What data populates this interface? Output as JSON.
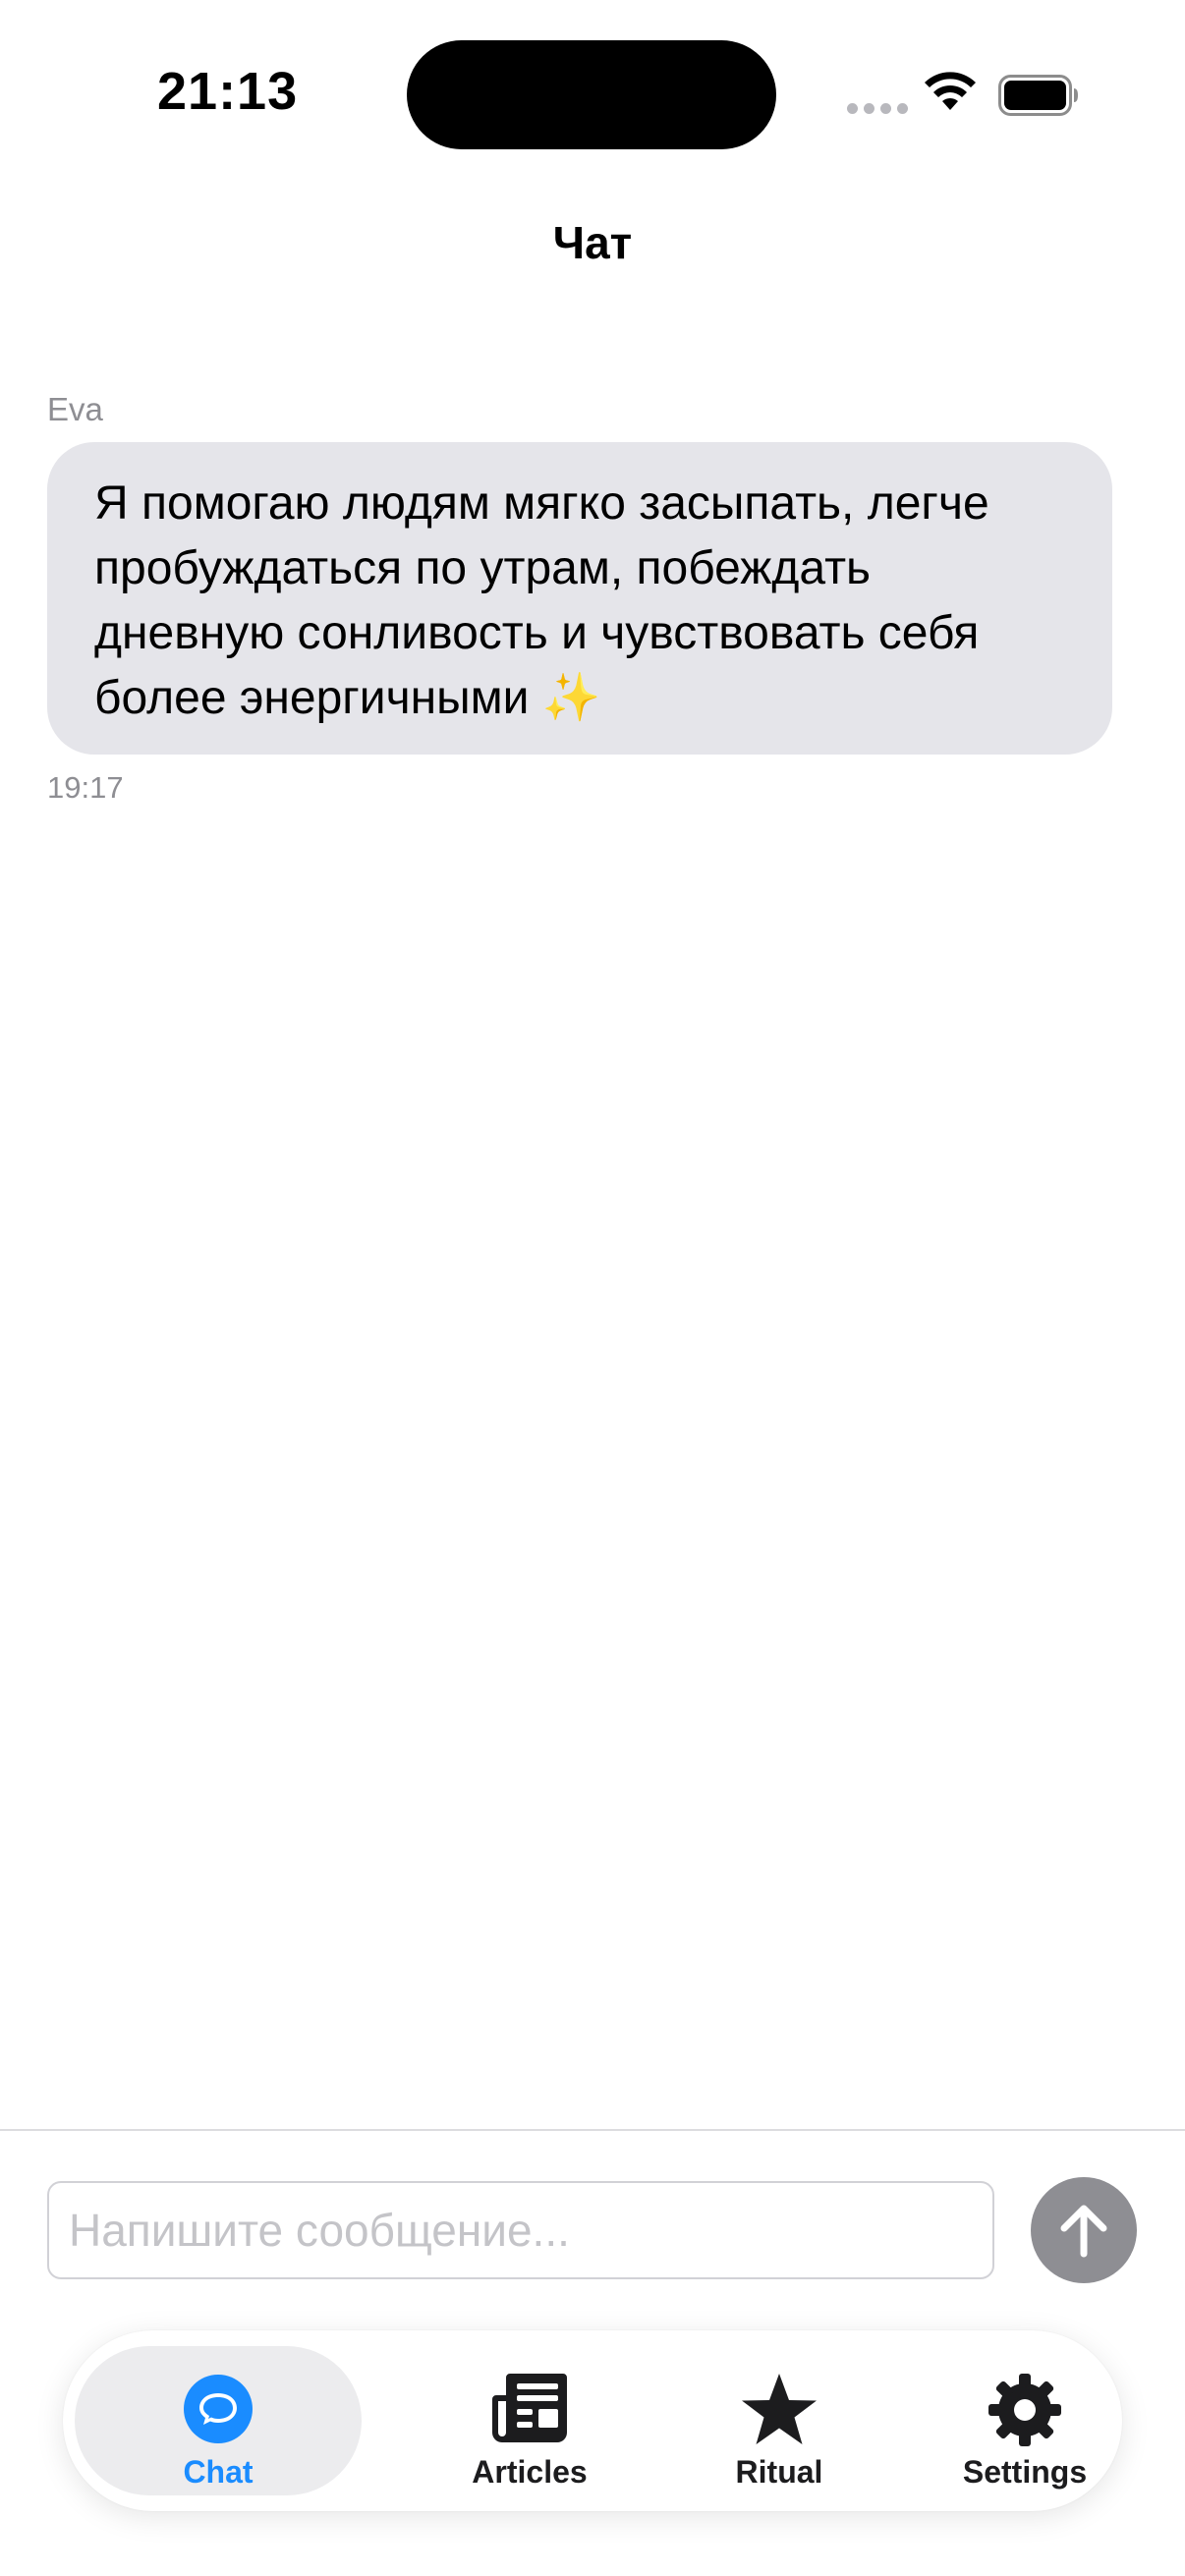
{
  "status_bar": {
    "time": "21:13"
  },
  "header": {
    "title": "Чат"
  },
  "messages": [
    {
      "sender": "Eva",
      "text": "Я помогаю людям мягко засыпать, легче пробуждаться по утрам, побеждать дневную сонливость и чувствовать себя более энергичными ✨",
      "time": "19:17"
    }
  ],
  "composer": {
    "placeholder": "Напишите сообщение...",
    "value": ""
  },
  "tabs": [
    {
      "label": "Chat",
      "icon": "chat-bubble-icon",
      "active": true
    },
    {
      "label": "Articles",
      "icon": "newspaper-icon",
      "active": false
    },
    {
      "label": "Ritual",
      "icon": "star-icon",
      "active": false
    },
    {
      "label": "Settings",
      "icon": "gear-icon",
      "active": false
    }
  ],
  "colors": {
    "accent": "#1a8cff",
    "bubble": "#e5e5ea",
    "send_disabled": "#8e8e93"
  }
}
